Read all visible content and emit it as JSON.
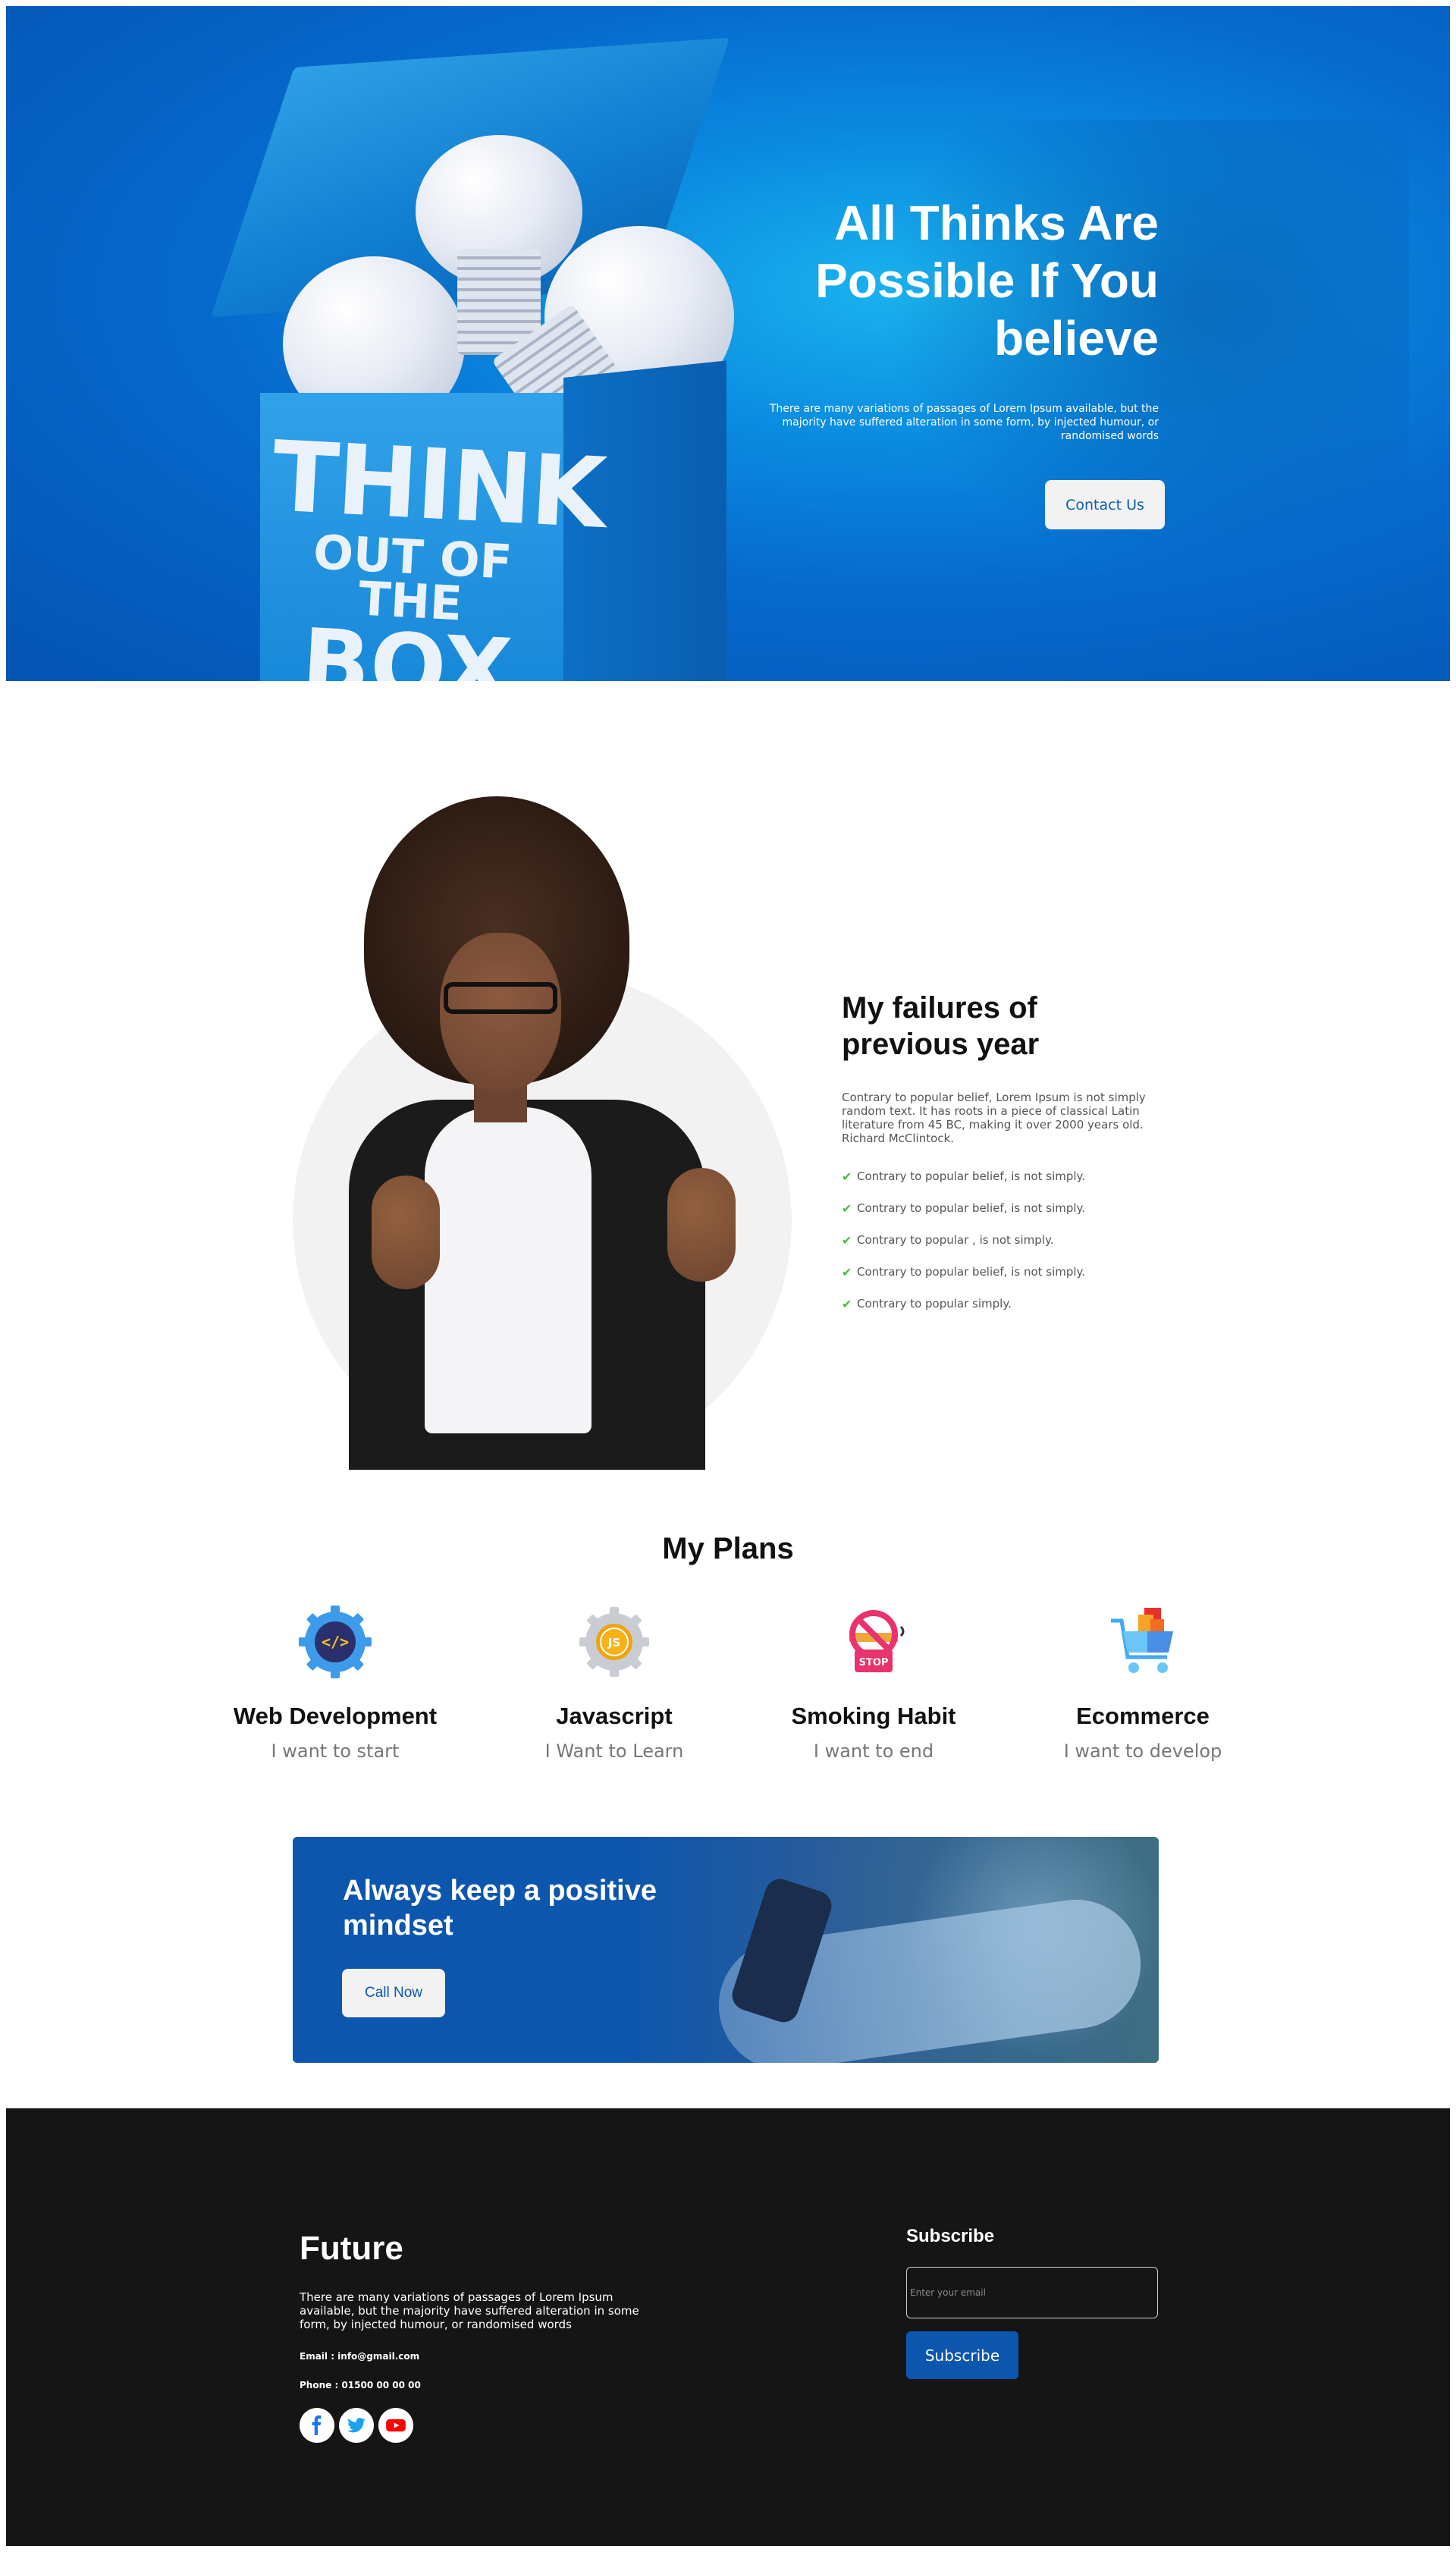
{
  "hero": {
    "box_text": {
      "line1": "THINK",
      "line2": "OUT OF THE",
      "line3": "BOX"
    },
    "title": "All Thinks Are Possible If You believe",
    "text": "There are many variations of passages of Lorem Ipsum available, but the majority have suffered alteration in some form, by injected humour, or randomised words",
    "cta_label": "Contact Us"
  },
  "failures": {
    "title": "My failures of previous year",
    "text": "Contrary to popular belief, Lorem Ipsum is not simply random text. It has roots in a piece of classical Latin literature from 45 BC, making it over 2000 years old. Richard McClintock.",
    "items": [
      "Contrary to popular belief, is not simply.",
      "Contrary to popular belief, is not simply.",
      "Contrary to popular , is not simply.",
      "Contrary to popular belief, is not simply.",
      "Contrary to popular simply."
    ]
  },
  "plans": {
    "title": "My Plans",
    "items": [
      {
        "icon": "code-gear-icon",
        "title": "Web Development",
        "subtitle": "I want to start"
      },
      {
        "icon": "js-gear-icon",
        "title": "Javascript",
        "subtitle": "I Want to Learn"
      },
      {
        "icon": "no-smoking-icon",
        "title": "Smoking Habit",
        "subtitle": "I want to end",
        "badge": "STOP"
      },
      {
        "icon": "shopping-cart-icon",
        "title": "Ecommerce",
        "subtitle": "I want to develop"
      }
    ]
  },
  "banner": {
    "title": "Always keep a positive mindset",
    "cta_label": "Call Now"
  },
  "footer": {
    "brand": "Future",
    "text": "There are many variations of passages of Lorem Ipsum available, but the majority have suffered alteration in some form, by injected humour, or randomised words",
    "email": "Email : info@gmail.com",
    "phone": "Phone : 01500 00 00 00",
    "social": [
      "facebook-icon",
      "twitter-icon",
      "youtube-icon"
    ],
    "subscribe_title": "Subscribe",
    "email_placeholder": "Enter your email",
    "subscribe_label": "Subscribe"
  },
  "colors": {
    "accent": "#0c56ad",
    "check": "#44c23a",
    "footer_bg": "#151515"
  }
}
